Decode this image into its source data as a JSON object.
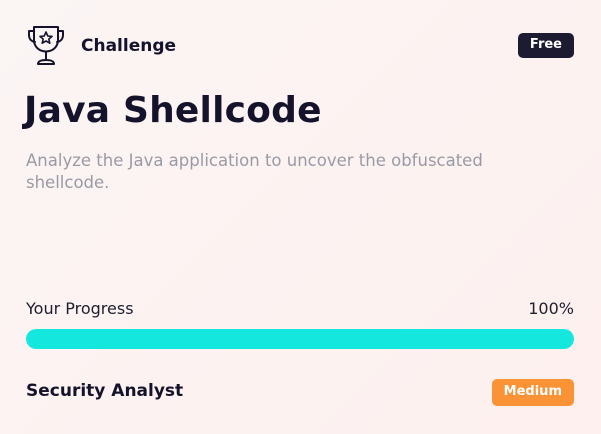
{
  "header": {
    "icon": "trophy-star-icon",
    "category": "Challenge",
    "access_badge": "Free",
    "access_badge_color": "#1c1b32"
  },
  "challenge": {
    "title": "Java Shellcode",
    "description": "Analyze the Java application to uncover the obfuscated shellcode."
  },
  "progress": {
    "label": "Your Progress",
    "value_text": "100%",
    "value": 100,
    "fill_color": "#14e8de"
  },
  "footer": {
    "role": "Security Analyst",
    "difficulty": "Medium",
    "difficulty_color": "#fa9336"
  }
}
